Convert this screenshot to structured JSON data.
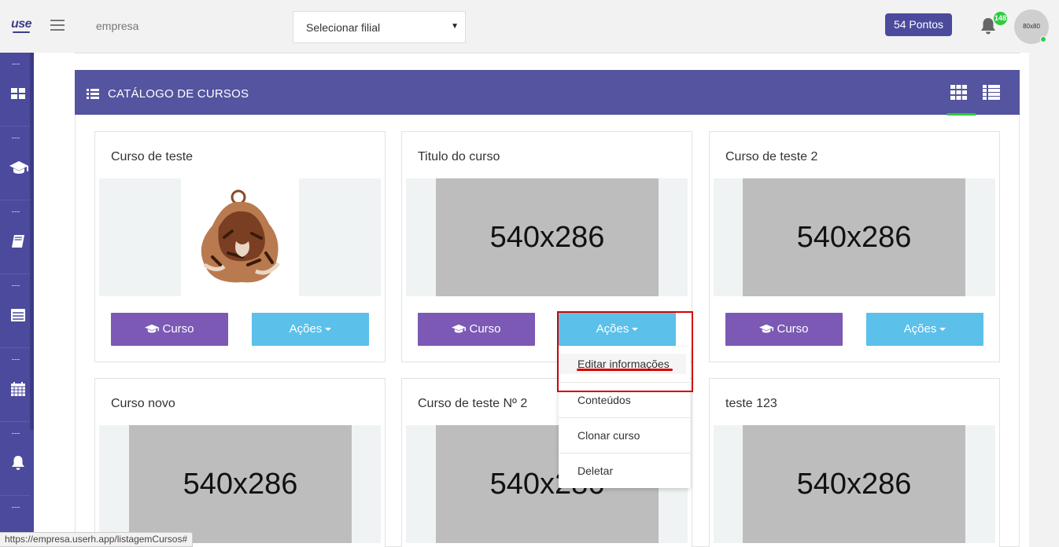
{
  "header": {
    "logo": "use",
    "company": "empresa",
    "branch_select": {
      "value": "Selecionar filial"
    },
    "points": "54 Pontos",
    "notification_count": "148",
    "avatar_text": "80x80"
  },
  "sidebar": {
    "items": [
      {
        "icon": "dashboard-icon"
      },
      {
        "icon": "graduation-cap-icon"
      },
      {
        "icon": "book-icon"
      },
      {
        "icon": "list-box-icon"
      },
      {
        "icon": "calendar-icon"
      },
      {
        "icon": "bell-icon"
      }
    ]
  },
  "catalog": {
    "title": "CATÁLOGO DE CURSOS",
    "view_modes": [
      "grid",
      "list"
    ],
    "active_view": "grid"
  },
  "cards": [
    {
      "title": "Curso de teste",
      "image": "illustration",
      "btn_course": "Curso",
      "btn_actions": "Ações"
    },
    {
      "title": "Titulo do curso",
      "image": "540x286",
      "btn_course": "Curso",
      "btn_actions": "Ações"
    },
    {
      "title": "Curso de teste 2",
      "image": "540x286",
      "btn_course": "Curso",
      "btn_actions": "Ações"
    },
    {
      "title": "Curso novo",
      "image": "540x286"
    },
    {
      "title": "Curso de teste Nº 2",
      "image": "540x286"
    },
    {
      "title": "teste 123",
      "image": "540x286"
    }
  ],
  "actions_menu": {
    "items": [
      "Editar informações",
      "Conteúdos",
      "Clonar curso",
      "Deletar"
    ]
  },
  "status_url": "https://empresa.userh.app/listagemCursos#",
  "colors": {
    "brand": "#4b4a9c",
    "panel_header": "#5454a0",
    "course_button": "#7b59b5",
    "actions_button": "#5bc0ea",
    "active_indicator": "#2ecc40",
    "highlight": "#d40000"
  }
}
